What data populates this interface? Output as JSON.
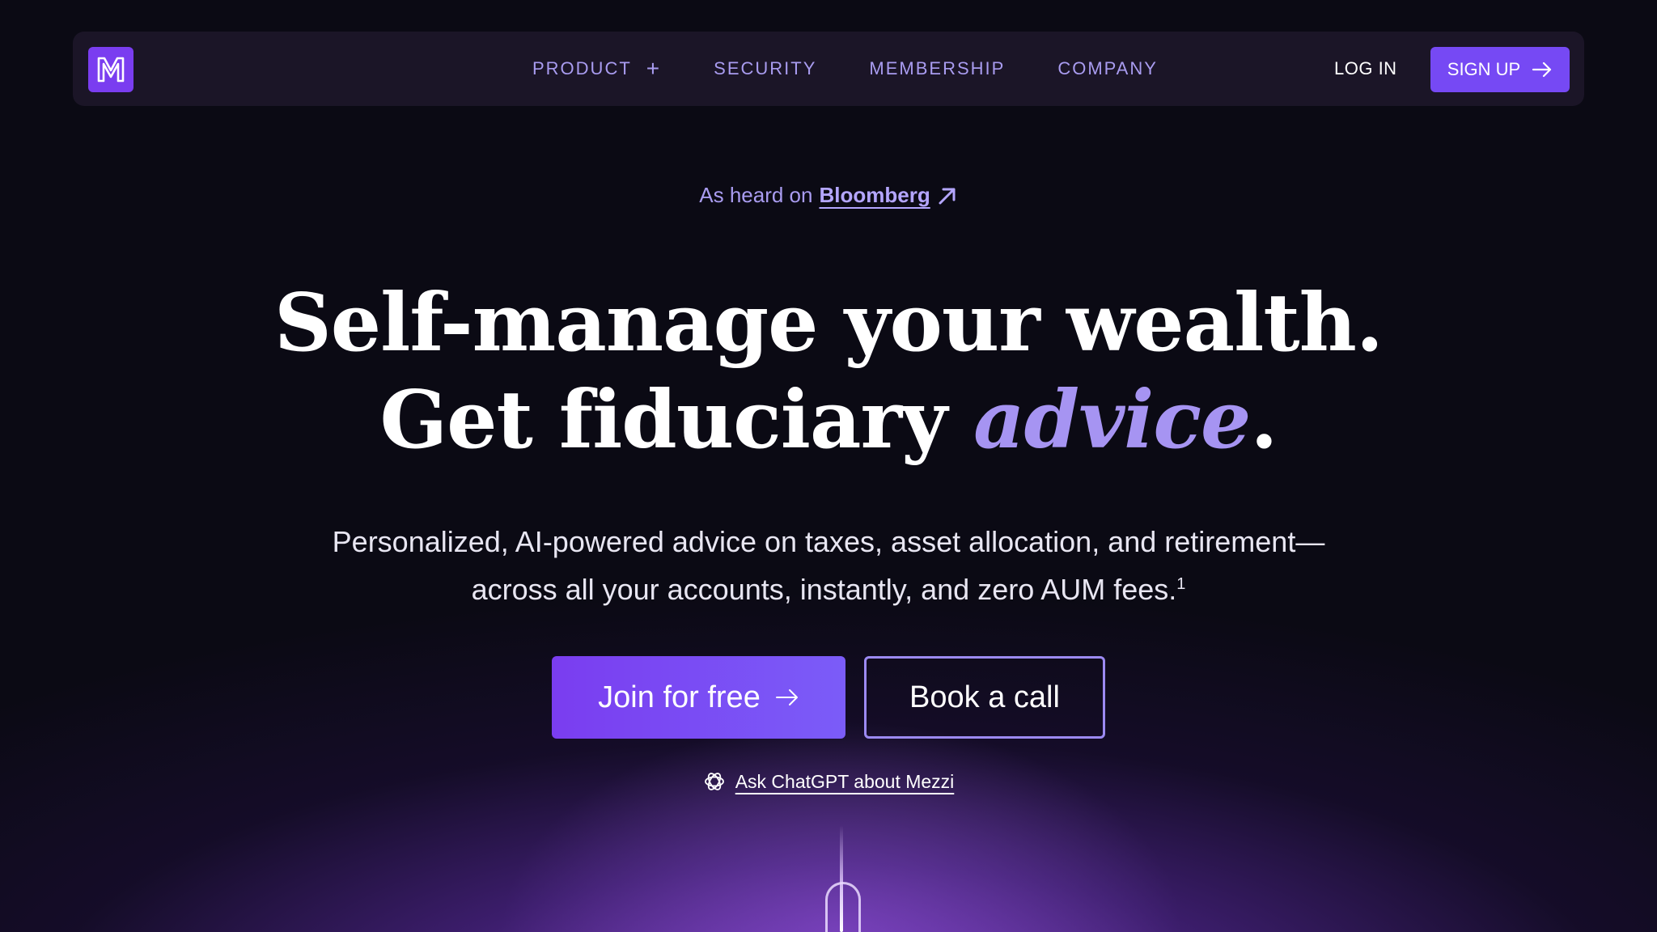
{
  "brand": {
    "logo_letter": "M",
    "accent_color": "#7a3df0"
  },
  "nav": {
    "links": [
      {
        "label": "PRODUCT"
      },
      {
        "label": "SECURITY"
      },
      {
        "label": "MEMBERSHIP"
      },
      {
        "label": "COMPANY"
      }
    ],
    "product_expand_symbol": "+",
    "login_label": "LOG IN",
    "signup_label": "SIGN UP"
  },
  "hero": {
    "heard_prefix": "As heard on",
    "heard_source": "Bloomberg",
    "headline_line1": "Self-manage your wealth.",
    "headline_line2_start": "Get fiduciary ",
    "headline_line2_accent": "advice",
    "headline_line2_end": ".",
    "subtext_line1": "Personalized, AI-powered advice on taxes, asset allocation, and retirement—",
    "subtext_line2": "across all your accounts, instantly, and zero AUM fees.",
    "subtext_footnote": "1",
    "join_label": "Join for free",
    "call_label": "Book a call",
    "ask_label": "Ask ChatGPT about Mezzi"
  },
  "icons": {
    "arrow": "arrow-right-icon",
    "external": "arrow-up-right-icon",
    "chatgpt": "chatgpt-icon"
  }
}
